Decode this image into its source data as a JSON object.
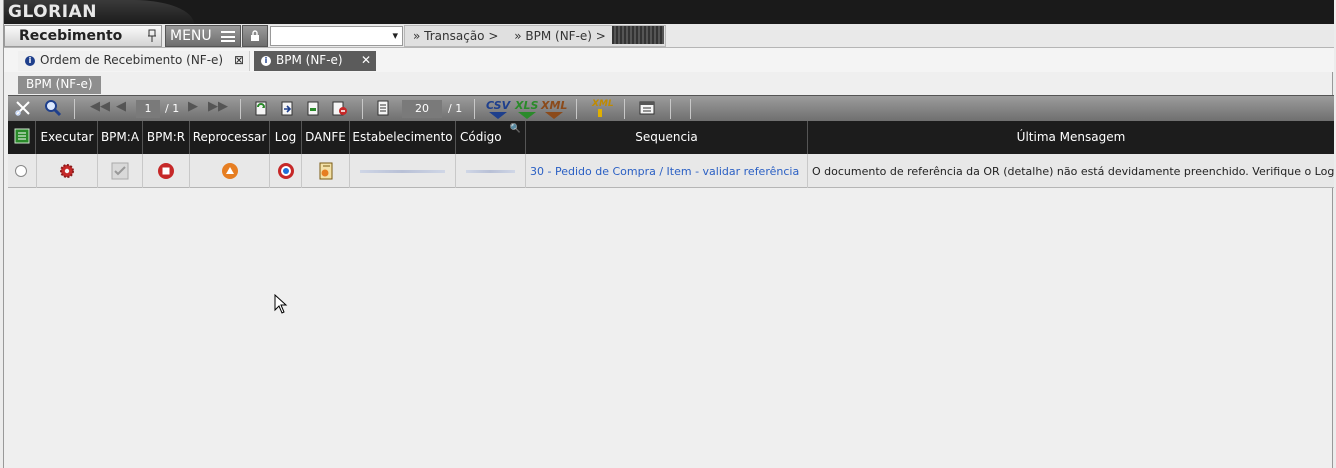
{
  "header": {
    "logo_text": "GLORIAN"
  },
  "modulebar": {
    "module_title": "Recebimento",
    "menu_label": "MENU",
    "select_value": "",
    "breadcrumb": [
      "Transação >",
      "BPM (NF-e) >"
    ]
  },
  "tabs": [
    {
      "label": "Ordem de Recebimento (NF-e)"
    },
    {
      "label": "BPM (NF-e)"
    }
  ],
  "subtab": {
    "label": "BPM (NF-e)"
  },
  "toolbar": {
    "page_current": "1",
    "page_total": "/ 1",
    "page_size": "20",
    "page_size_total": "/ 1",
    "export_csv": "CSV",
    "export_xls": "XLS",
    "export_xml": "XML",
    "export_xml2": "XML"
  },
  "grid": {
    "columns": [
      "Executar",
      "BPM:A",
      "BPM:R",
      "Reprocessar",
      "Log",
      "DANFE",
      "Estabelecimento",
      "Código",
      "Sequencia",
      "Última Mensagem"
    ],
    "rows": [
      {
        "sequencia": "30 - Pedido de Compra / Item - validar referência",
        "ultima_mensagem": "O documento de referência da OR (detalhe) não está devidamente preenchido. Verifique o Log"
      }
    ]
  },
  "colors": {
    "header_bg": "#1c1c1c",
    "toolbar_bg": "#8a8a8a",
    "link": "#2b60c4",
    "active_tab": "#5b5b5b"
  }
}
